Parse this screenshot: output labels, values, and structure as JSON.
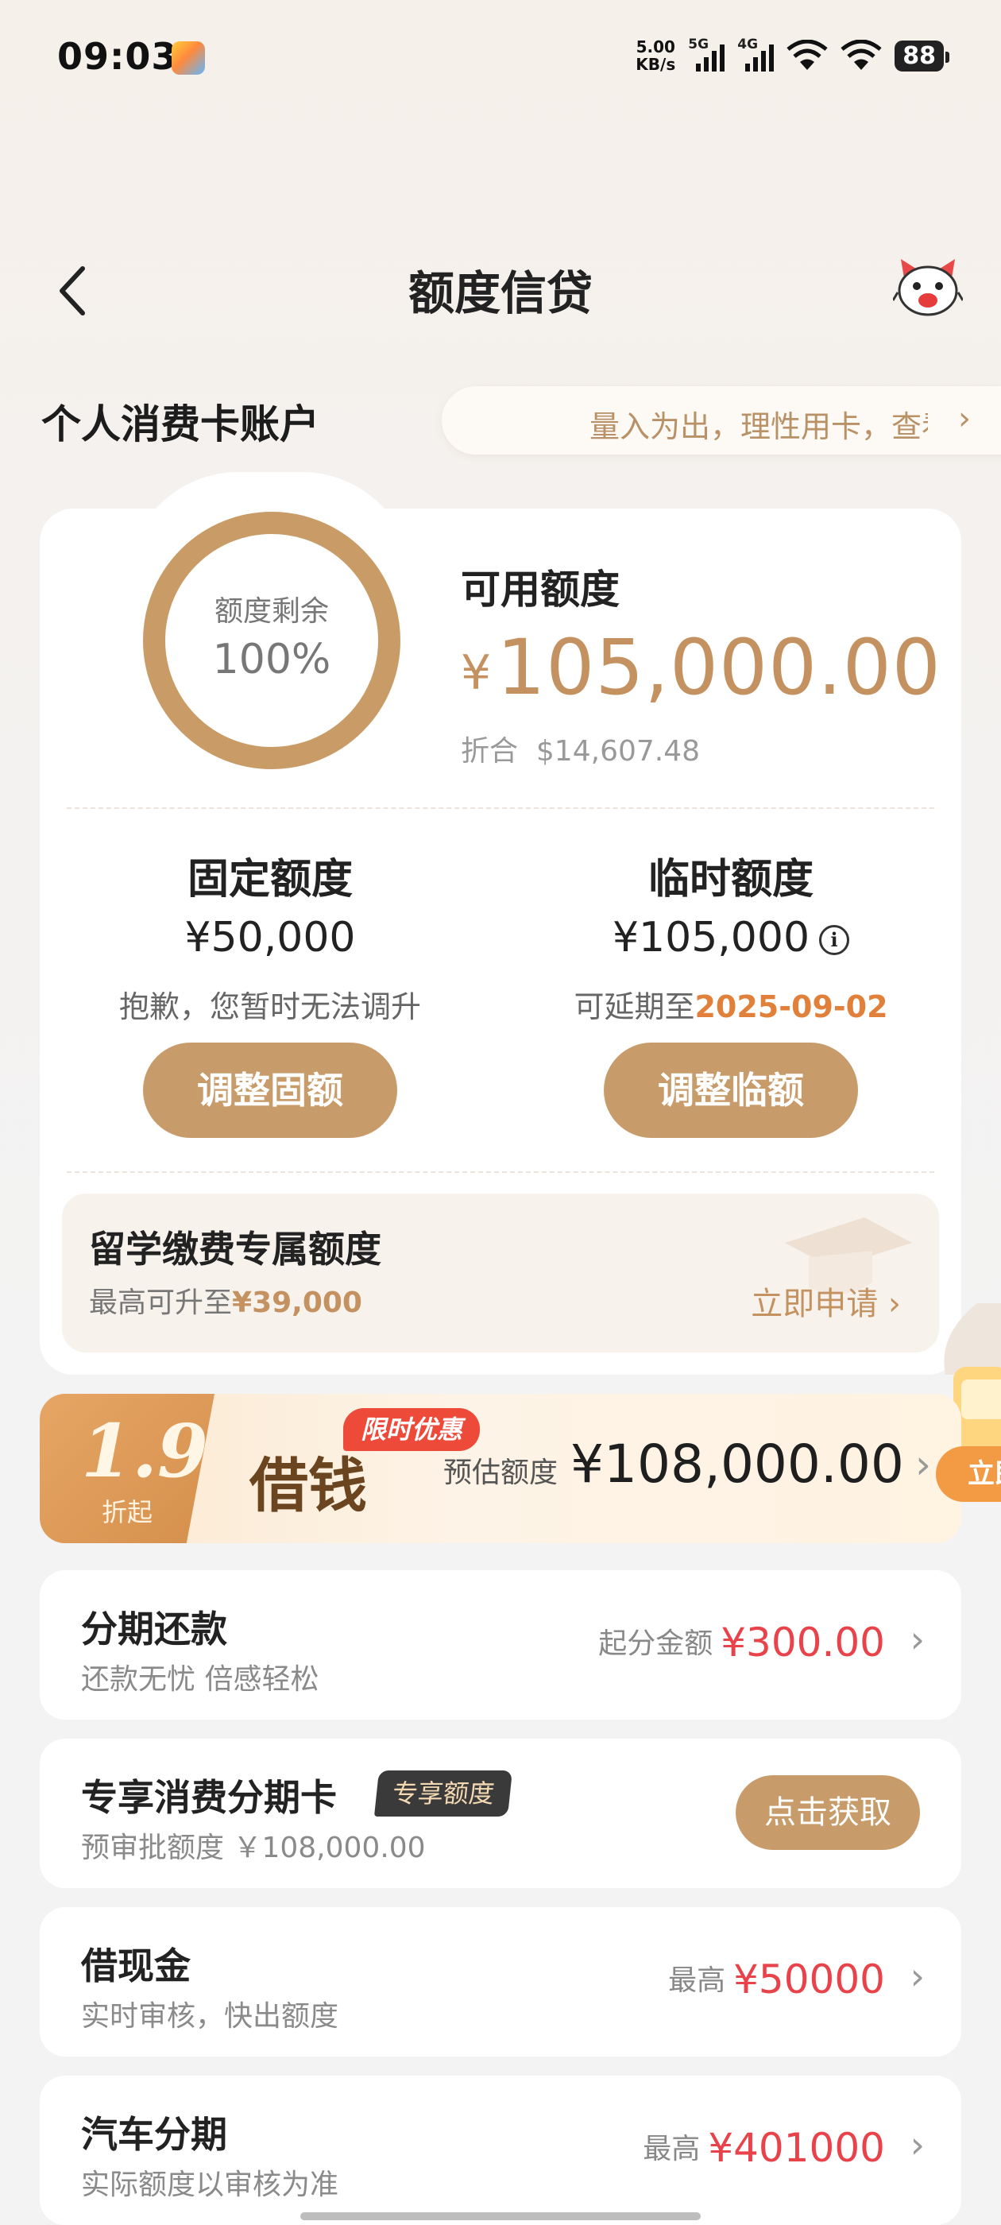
{
  "status_bar": {
    "time": "09:03",
    "net_speed_value": "5.00",
    "net_speed_unit": "KB/s",
    "signal1_label": "5G",
    "signal2_label": "4G",
    "battery": "88"
  },
  "header": {
    "title": "额度信贷",
    "back_icon": "back-arrow-icon",
    "service_icon": "mascot-cat-icon"
  },
  "account": {
    "section_title": "个人消费卡账户",
    "marquee_text": "量入为出，理性用卡，查看",
    "ring_label": "额度剩余",
    "ring_percent": "100%",
    "remaining_fraction": 1.0,
    "available_label": "可用额度",
    "available_currency": "¥",
    "available_amount": "105,000.00",
    "usd_label": "折合",
    "usd_amount": "$14,607.48"
  },
  "fixed_limit": {
    "title": "固定额度",
    "amount": "¥50,000",
    "note": "抱歉，您暂时无法调升",
    "button": "调整固额"
  },
  "temp_limit": {
    "title": "临时额度",
    "amount": "¥105,000",
    "note_prefix": "可延期至",
    "date": "2025-09-02",
    "button": "调整临额"
  },
  "study": {
    "title": "留学缴费专属额度",
    "sub_prefix": "最高可升至",
    "sub_amount": "¥39,000",
    "link": "立即申请"
  },
  "banner": {
    "rate": "1.9",
    "rate_suffix": "折起",
    "product": "借钱",
    "tag": "限时优惠",
    "est_label": "预估额度",
    "est_amount": "¥108,000.00",
    "side_button": "立即"
  },
  "items": [
    {
      "title": "分期还款",
      "sub": "还款无忧 倍感轻松",
      "right_label": "起分金额",
      "right_value": "¥300.00"
    },
    {
      "title": "专享消费分期卡",
      "badge": "专享额度",
      "sub": "预审批额度 ￥108,000.00",
      "button": "点击获取"
    },
    {
      "title": "借现金",
      "sub": "实时审核，快出额度",
      "right_label": "最高",
      "right_value": "¥50000"
    },
    {
      "title": "汽车分期",
      "sub": "实际额度以审核为准",
      "right_label": "最高",
      "right_value": "¥401000"
    }
  ],
  "colors": {
    "accent": "#c89c6a",
    "red": "#e8434a",
    "date_orange": "#e0803a"
  }
}
